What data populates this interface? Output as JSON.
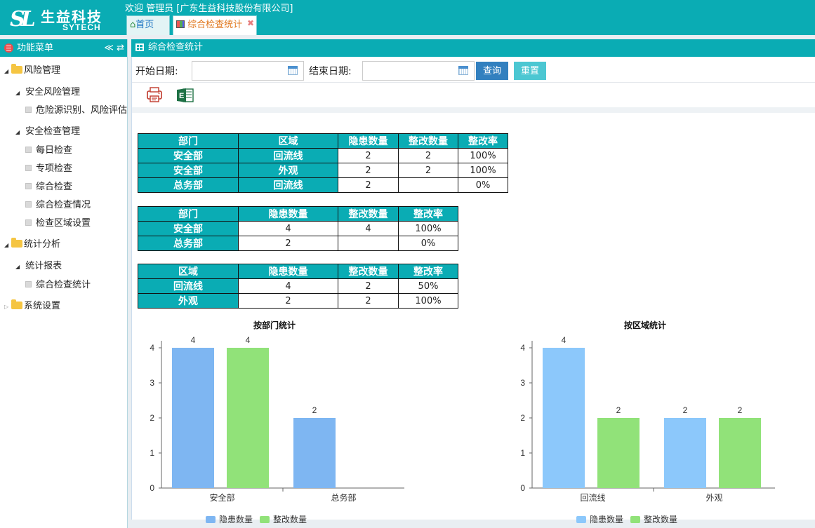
{
  "header": {
    "logo_cn": "生益科技",
    "logo_en": "SYTECH",
    "logo_mark": "SL",
    "welcome": "欢迎 管理员 [广东生益科技股份有限公司]"
  },
  "tabs": [
    {
      "label": "首页",
      "icon": "home-icon"
    },
    {
      "label": "综合检查统计",
      "icon": "report-icon",
      "close": "✖"
    }
  ],
  "sidebar": {
    "title": "功能菜单",
    "collapse": "≪",
    "refresh": "⇄",
    "items": [
      {
        "label": "风险管理"
      },
      {
        "label": "安全风险管理"
      },
      {
        "label": "危险源识别、风险评估"
      },
      {
        "label": "安全检查管理"
      },
      {
        "label": "每日检查"
      },
      {
        "label": "专项检查"
      },
      {
        "label": "综合检查"
      },
      {
        "label": "综合检查情况"
      },
      {
        "label": "检查区域设置"
      },
      {
        "label": "统计分析"
      },
      {
        "label": "统计报表"
      },
      {
        "label": "综合检查统计"
      },
      {
        "label": "系统设置"
      }
    ]
  },
  "panel": {
    "title": "综合检查统计"
  },
  "search": {
    "start_label": "开始日期:",
    "end_label": "结束日期:",
    "start_value": "",
    "end_value": "",
    "query": "查询",
    "reset": "重置"
  },
  "colors": {
    "teal": "#0aacb4",
    "bar_blue_dept": "#7eb6f2",
    "bar_blue_area": "#8cc8fb",
    "bar_green": "#91e279"
  },
  "table1": {
    "headers": [
      "部门",
      "区域",
      "隐患数量",
      "整改数量",
      "整改率"
    ],
    "rows": [
      [
        "安全部",
        "回流线",
        "2",
        "2",
        "100%"
      ],
      [
        "安全部",
        "外观",
        "2",
        "2",
        "100%"
      ],
      [
        "总务部",
        "回流线",
        "2",
        "",
        "0%"
      ]
    ]
  },
  "table2": {
    "headers": [
      "部门",
      "隐患数量",
      "整改数量",
      "整改率"
    ],
    "rows": [
      [
        "安全部",
        "4",
        "4",
        "100%"
      ],
      [
        "总务部",
        "2",
        "",
        "0%"
      ]
    ]
  },
  "table3": {
    "headers": [
      "区域",
      "隐患数量",
      "整改数量",
      "整改率"
    ],
    "rows": [
      [
        "回流线",
        "4",
        "2",
        "50%"
      ],
      [
        "外观",
        "2",
        "2",
        "100%"
      ]
    ]
  },
  "chart_data": [
    {
      "type": "bar",
      "title": "按部门统计",
      "categories": [
        "安全部",
        "总务部"
      ],
      "ylim": [
        0,
        4
      ],
      "yticks": [
        0,
        1,
        2,
        3,
        4
      ],
      "series": [
        {
          "name": "隐患数量",
          "values": [
            4,
            2
          ]
        },
        {
          "name": "整改数量",
          "values": [
            4,
            null
          ]
        }
      ],
      "legend": "bottom"
    },
    {
      "type": "bar",
      "title": "按区域统计",
      "categories": [
        "回流线",
        "外观"
      ],
      "ylim": [
        0,
        4
      ],
      "yticks": [
        0,
        1,
        2,
        3,
        4
      ],
      "series": [
        {
          "name": "隐患数量",
          "values": [
            4,
            2
          ]
        },
        {
          "name": "整改数量",
          "values": [
            2,
            2
          ]
        }
      ],
      "legend": "bottom"
    }
  ]
}
